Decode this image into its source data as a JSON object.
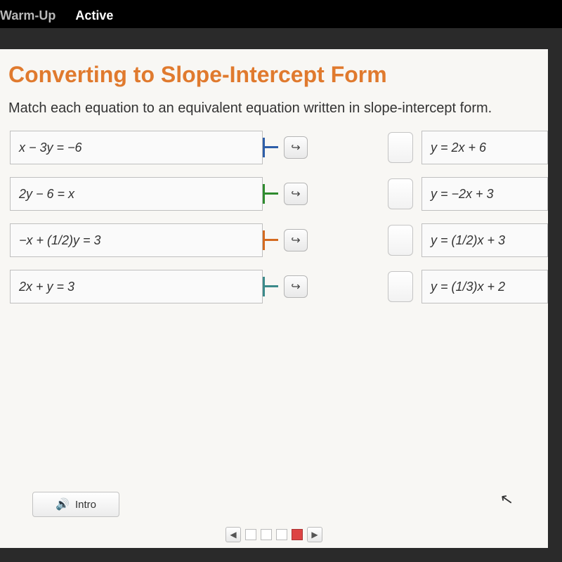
{
  "tabs": {
    "left": "Warm-Up",
    "right": "Active"
  },
  "title": "Converting to Slope-Intercept Form",
  "instruction": "Match each equation to an equivalent equation written in slope-intercept form.",
  "left_eqs": [
    "x − 3y = −6",
    "2y − 6 = x",
    "−x + (1/2)y = 3",
    "2x + y = 3"
  ],
  "right_eqs": [
    "y = 2x + 6",
    "y = −2x + 3",
    "y = (1/2)x + 3",
    "y = (1/3)x + 2"
  ],
  "intro_label": "Intro",
  "arrow_glyph": "↪",
  "nav_prev": "◀",
  "nav_next": "▶"
}
